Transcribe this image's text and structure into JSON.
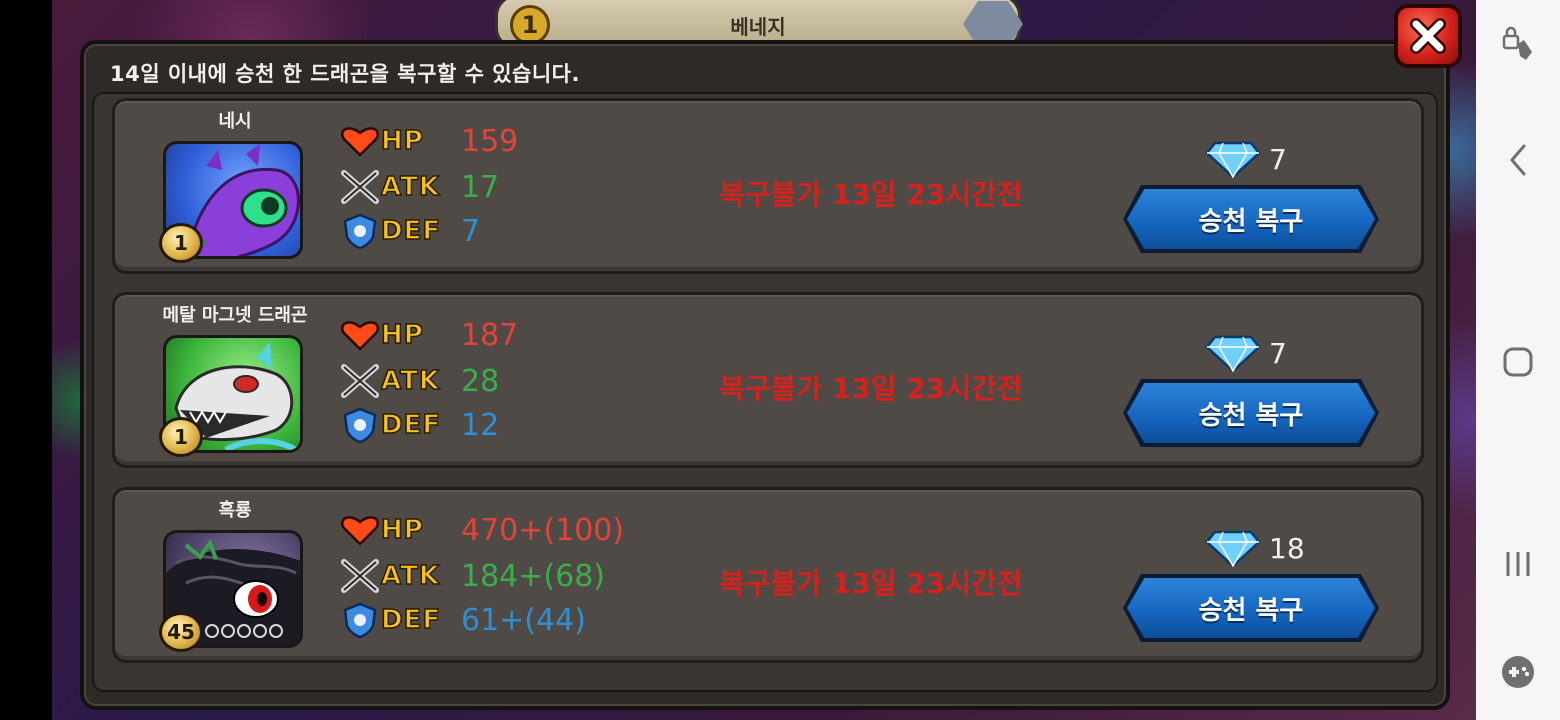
{
  "top_tab": {
    "badge": "1",
    "title": "베네지"
  },
  "dialog": {
    "message": "14일 이내에 승천 한 드래곤을 복구할 수 있습니다.",
    "close_icon": "close-x-icon"
  },
  "stat_labels": {
    "hp": "HP",
    "atk": "ATK",
    "def": "DEF"
  },
  "cards": [
    {
      "name": "네시",
      "level": "1",
      "stars_empty": 0,
      "hp": "159",
      "atk": "17",
      "def": "7",
      "restore_note": "복구불가 13일 23시간전",
      "gem_cost": "7",
      "button_label": "승천 복구",
      "portrait_color": "purple"
    },
    {
      "name": "메탈 마그넷 드래곤",
      "level": "1",
      "stars_empty": 0,
      "hp": "187",
      "atk": "28",
      "def": "12",
      "restore_note": "복구불가 13일 23시간전",
      "gem_cost": "7",
      "button_label": "승천 복구",
      "portrait_color": "green"
    },
    {
      "name": "흑룡",
      "level": "45",
      "stars_empty": 5,
      "hp": "470+(100)",
      "atk": "184+(68)",
      "def": "61+(44)",
      "restore_note": "복구불가 13일 23시간전",
      "gem_cost": "18",
      "button_label": "승천 복구",
      "portrait_color": "dark"
    }
  ],
  "colors": {
    "hp": "#e2443a",
    "atk": "#3aae4c",
    "def": "#2d8fd4",
    "restore_note": "#d4221d",
    "button": "#1667c0"
  },
  "navbar": {
    "icons": [
      "touch-lock-icon",
      "back-icon",
      "home-icon",
      "recents-icon",
      "game-tools-icon"
    ]
  }
}
